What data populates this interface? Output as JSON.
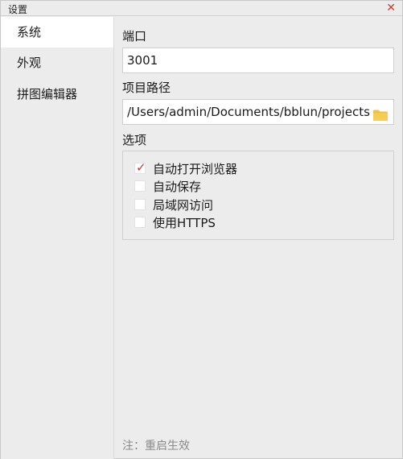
{
  "window": {
    "title": "设置",
    "close_symbol": "✕"
  },
  "sidebar": {
    "items": [
      {
        "label": "系统",
        "active": true
      },
      {
        "label": "外观",
        "active": false
      },
      {
        "label": "拼图编辑器",
        "active": false
      }
    ]
  },
  "port": {
    "label": "端口",
    "value": "3001"
  },
  "project_path": {
    "label": "项目路径",
    "value": "/Users/admin/Documents/bblun/projects",
    "icon": "folder-icon"
  },
  "options": {
    "label": "选项",
    "items": [
      {
        "label": "自动打开浏览器",
        "checked": true
      },
      {
        "label": "自动保存",
        "checked": false
      },
      {
        "label": "局域网访问",
        "checked": false
      },
      {
        "label": "使用HTTPS",
        "checked": false
      }
    ]
  },
  "note": "注：重启生效",
  "colors": {
    "accent_red": "#c0392b",
    "folder_yellow": "#f3c045"
  }
}
